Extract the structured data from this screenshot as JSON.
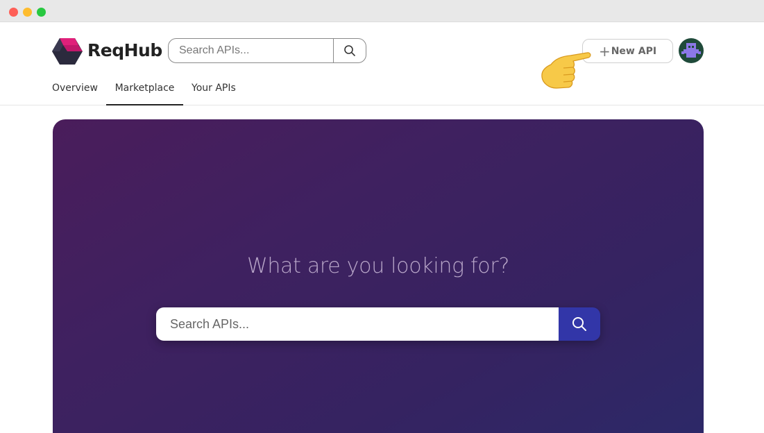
{
  "window": {
    "controls": [
      "close",
      "minimize",
      "maximize"
    ]
  },
  "header": {
    "brand": "ReqHub",
    "logo_icon": "cube-logo-icon",
    "search": {
      "placeholder": "Search APIs...",
      "icon": "search-icon"
    },
    "new_api_button": {
      "plus": "+",
      "label": "New API",
      "icon": "plus-icon"
    },
    "avatar_icon": "pixel-avatar-icon",
    "pointer_icon": "pointing-hand-icon",
    "tabs": [
      {
        "label": "Overview",
        "active": false
      },
      {
        "label": "Marketplace",
        "active": true
      },
      {
        "label": "Your APIs",
        "active": false
      }
    ]
  },
  "hero": {
    "title": "What are you looking for?",
    "search": {
      "placeholder": "Search APIs...",
      "icon": "search-icon"
    }
  },
  "colors": {
    "hero_gradient_start": "#4a1d5b",
    "hero_gradient_end": "#2c2968",
    "search_button": "#3236a8",
    "logo_pink": "#e0207a",
    "logo_dark": "#2a2a3a"
  }
}
